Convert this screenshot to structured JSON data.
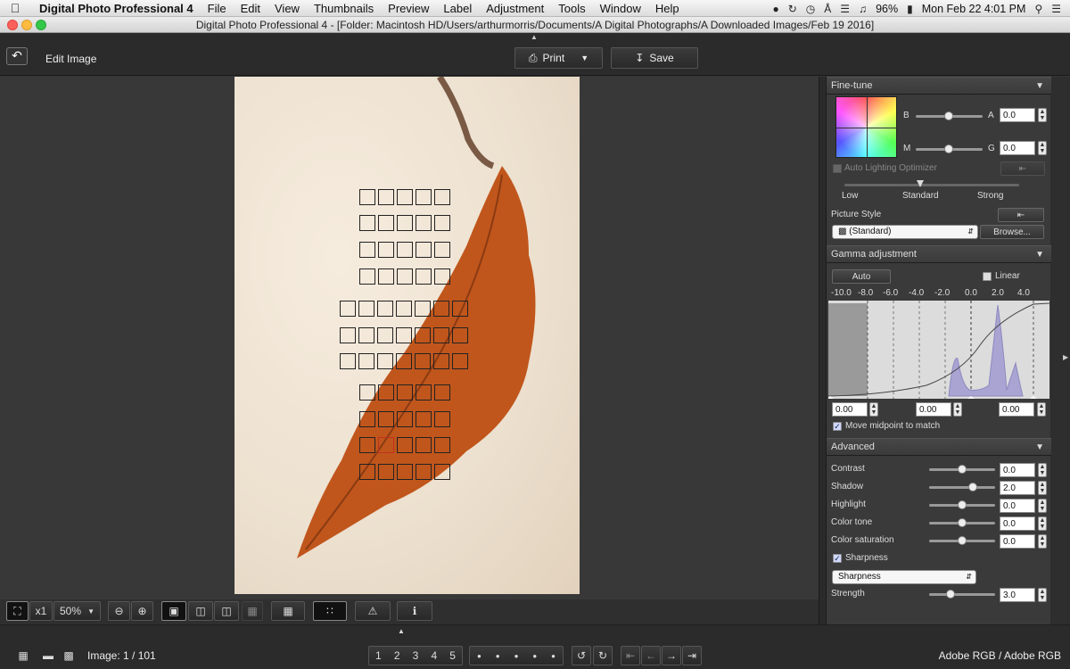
{
  "menubar": {
    "app_name": "Digital Photo Professional 4",
    "items": [
      "File",
      "Edit",
      "View",
      "Thumbnails",
      "Preview",
      "Label",
      "Adjustment",
      "Tools",
      "Window",
      "Help"
    ],
    "battery": "96%",
    "clock": "Mon Feb 22  4:01 PM"
  },
  "window": {
    "title": "Digital Photo Professional 4 - [Folder: Macintosh HD/Users/arthurmorris/Documents/A Digital Photographs/A Downloaded Images/Feb 19 2016]"
  },
  "toolbar": {
    "title": "Edit Image",
    "print_label": "Print",
    "save_label": "Save"
  },
  "bottombar": {
    "zoom_fit_label": "x1",
    "zoom_value": "50%"
  },
  "statusbar": {
    "image_counter": "Image: 1 / 101",
    "ratings": [
      "1",
      "2",
      "3",
      "4",
      "5"
    ],
    "color_space": "Adobe RGB / Adobe RGB"
  },
  "fine_tune": {
    "header": "Fine-tune",
    "b_label": "B",
    "a_label": "A",
    "a_value": "0.0",
    "m_label": "M",
    "g_label": "G",
    "g_value": "0.0",
    "alo_label": "Auto Lighting Optimizer",
    "alo_levels": [
      "Low",
      "Standard",
      "Strong"
    ],
    "picture_style_label": "Picture Style",
    "picture_style_value": "(Standard)",
    "browse_label": "Browse..."
  },
  "gamma": {
    "header": "Gamma adjustment",
    "auto_label": "Auto",
    "linear_label": "Linear",
    "axis_ticks": [
      "-10.0",
      "-8.0",
      "-6.0",
      "-4.0",
      "-2.0",
      "0.0",
      "2.0",
      "4.0"
    ],
    "black_point": "0.00",
    "midpoint": "0.00",
    "white_point": "0.00",
    "move_midpoint_label": "Move midpoint to match",
    "move_midpoint_checked": true
  },
  "advanced": {
    "header": "Advanced",
    "rows": [
      {
        "label": "Contrast",
        "value": "0.0",
        "level": 0.5
      },
      {
        "label": "Shadow",
        "value": "2.0",
        "level": 0.68
      },
      {
        "label": "Highlight",
        "value": "0.0",
        "level": 0.5
      },
      {
        "label": "Color tone",
        "value": "0.0",
        "level": 0.5
      },
      {
        "label": "Color saturation",
        "value": "0.0",
        "level": 0.5
      }
    ],
    "sharpness_checkbox_label": "Sharpness",
    "sharpness_mode": "Sharpness",
    "strength_label": "Strength",
    "strength_value": "3.0",
    "strength_level": 0.3
  },
  "colors": {
    "accent_red": "#c0311e",
    "leaf_orange": "#c0561c",
    "histogram_fill": "#a9a4d2"
  }
}
